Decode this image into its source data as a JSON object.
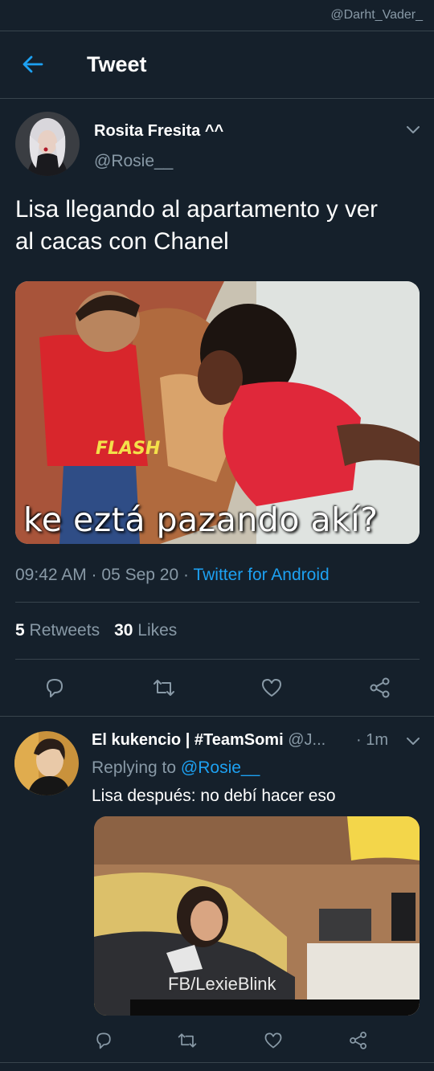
{
  "watermark": "@Darht_Vader_",
  "header": {
    "title": "Tweet"
  },
  "main_tweet": {
    "author_name": "Rosita Fresita ^^",
    "author_handle": "@Rosie__",
    "text_line1": "Lisa llegando al apartamento y ver",
    "text_line2": "al cacas con Chanel",
    "image_caption": "ke eztá pazando akí?",
    "time": "09:42 AM · 05 Sep 20 · ",
    "source": "Twitter for Android",
    "retweets_count": "5",
    "retweets_label": "Retweets",
    "likes_count": "30",
    "likes_label": "Likes"
  },
  "reply": {
    "author_name": "El kukencio | #TeamSomi",
    "author_handle": "@J...",
    "time": "· 1m",
    "replying_prefix": "Replying to ",
    "replying_handle": "@Rosie__",
    "text": "Lisa después: no debí hacer eso",
    "image_watermark": "FB/LexieBlink"
  },
  "colors": {
    "background": "#15202b",
    "accent": "#1da1f2",
    "secondary": "#8899a6",
    "divider": "#38444d"
  },
  "icons": [
    "back-arrow-icon",
    "chevron-down-icon",
    "reply-icon",
    "retweet-icon",
    "like-icon",
    "share-icon"
  ]
}
